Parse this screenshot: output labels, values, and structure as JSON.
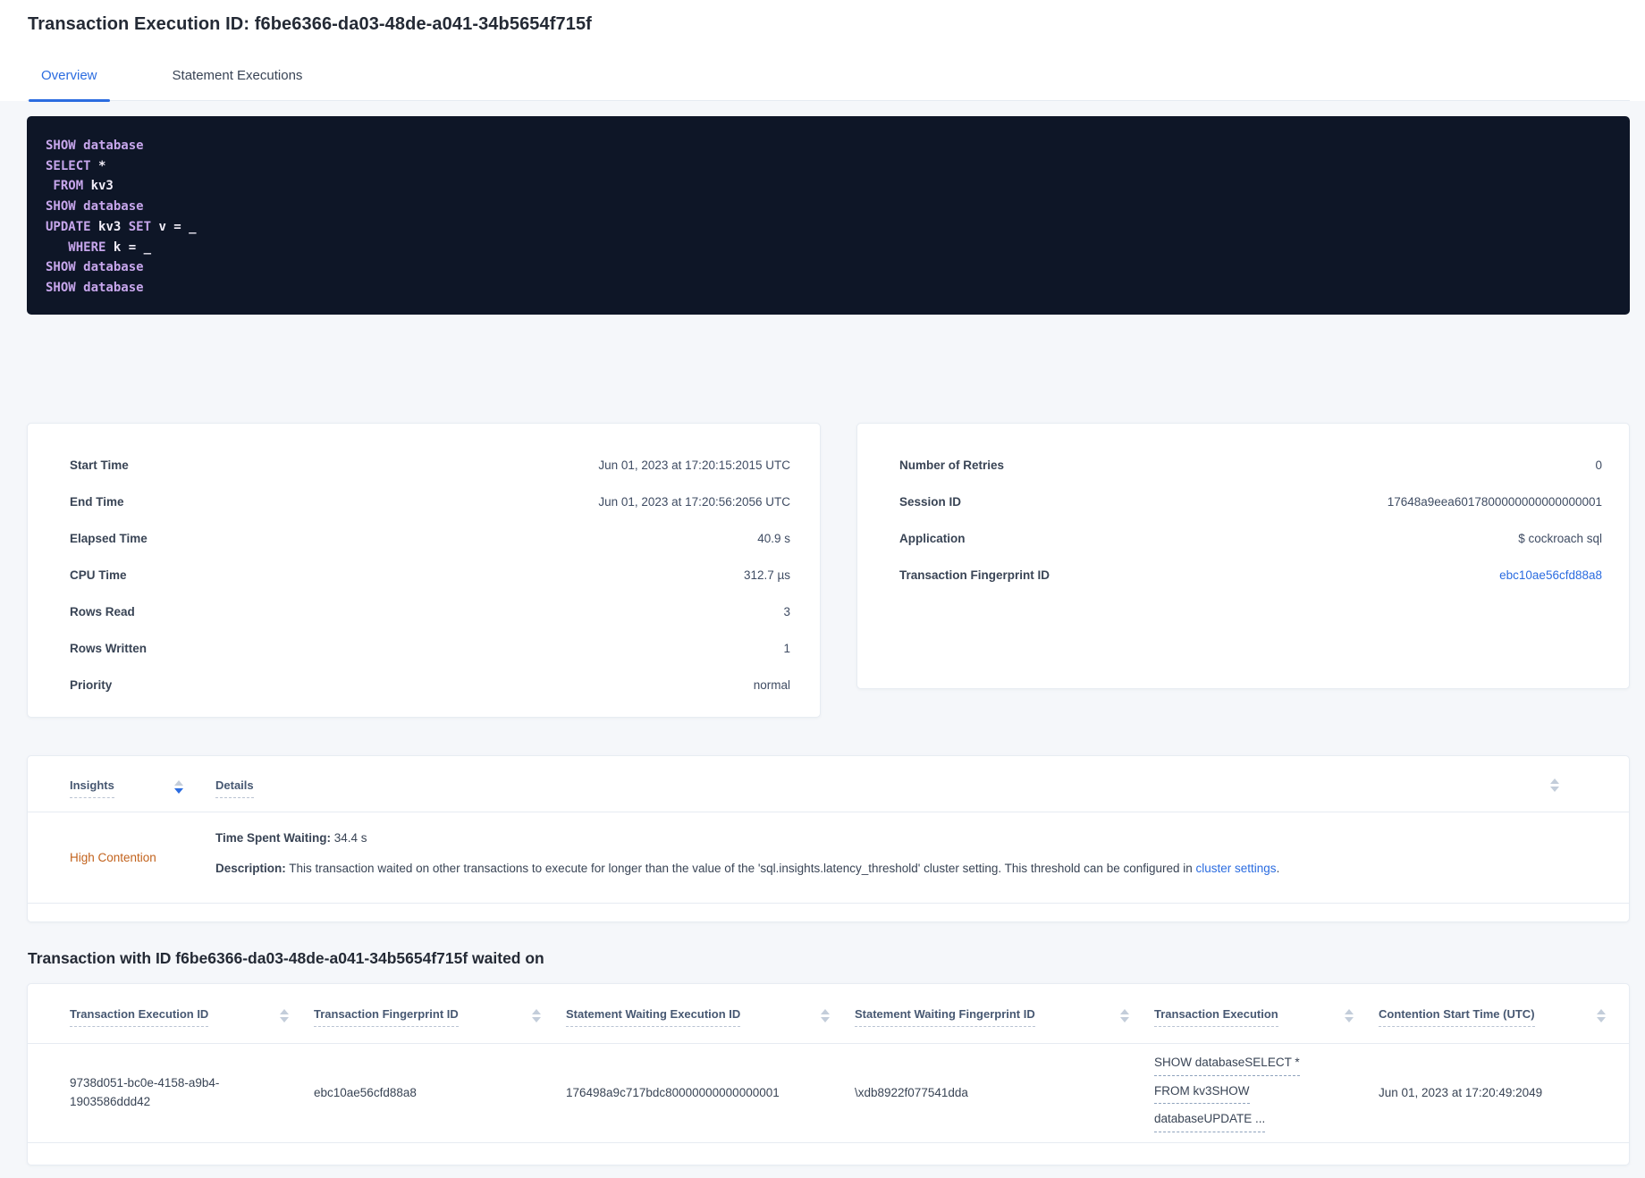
{
  "header": {
    "title": "Transaction Execution ID: f6be6366-da03-48de-a041-34b5654f715f"
  },
  "tabs": {
    "overview": "Overview",
    "statement_executions": "Statement Executions"
  },
  "sql_box": {
    "lines": [
      [
        {
          "text": "SHOW database",
          "kw": true
        }
      ],
      [
        {
          "text": "SELECT ",
          "kw": true
        },
        {
          "text": "*",
          "kw": false
        }
      ],
      [
        {
          "text": " FROM ",
          "kw": true
        },
        {
          "text": "kv3",
          "kw": false
        }
      ],
      [
        {
          "text": "SHOW database",
          "kw": true
        }
      ],
      [
        {
          "text": "UPDATE ",
          "kw": true
        },
        {
          "text": "kv3 ",
          "kw": false
        },
        {
          "text": "SET ",
          "kw": true
        },
        {
          "text": "v = _",
          "kw": false
        }
      ],
      [
        {
          "text": "   WHERE ",
          "kw": true
        },
        {
          "text": "k = _",
          "kw": false
        }
      ],
      [
        {
          "text": "SHOW database",
          "kw": true
        }
      ],
      [
        {
          "text": "SHOW database",
          "kw": true
        }
      ]
    ]
  },
  "summary_left": {
    "rows": [
      {
        "label": "Start Time",
        "value": "Jun 01, 2023 at 17:20:15:2015 UTC"
      },
      {
        "label": "End Time",
        "value": "Jun 01, 2023 at 17:20:56:2056 UTC"
      },
      {
        "label": "Elapsed Time",
        "value": "40.9 s"
      },
      {
        "label": "CPU Time",
        "value": "312.7 µs"
      },
      {
        "label": "Rows Read",
        "value": "3"
      },
      {
        "label": "Rows Written",
        "value": "1"
      },
      {
        "label": "Priority",
        "value": "normal"
      }
    ]
  },
  "summary_right": {
    "rows": [
      {
        "label": "Number of Retries",
        "value": "0"
      },
      {
        "label": "Session ID",
        "value": "17648a9eea6017800000000000000001"
      },
      {
        "label": "Application",
        "value": "$ cockroach sql"
      },
      {
        "label": "Transaction Fingerprint ID",
        "value": "ebc10ae56cfd88a8"
      }
    ]
  },
  "insights": {
    "columns": {
      "insights_label": "Insights",
      "details_label": "Details"
    },
    "row": {
      "insight": "High Contention",
      "waiting_label": "Time Spent Waiting:",
      "waiting_value": " 34.4 s",
      "description_label": "Description:",
      "description_text": " This transaction waited on other transactions to execute for longer than the value of the 'sql.insights.latency_threshold' cluster setting. This threshold can be configured in ",
      "description_link": "cluster settings",
      "description_suffix": "."
    }
  },
  "waited_on": {
    "heading": "Transaction with ID f6be6366-da03-48de-a041-34b5654f715f waited on",
    "columns": [
      "Transaction Execution ID",
      "Transaction Fingerprint ID",
      "Statement Waiting Execution ID",
      "Statement Waiting Fingerprint ID",
      "Transaction Execution",
      "Contention Start Time (UTC)"
    ],
    "row": {
      "transaction_execution_id": "9738d051-bc0e-4158-a9b4-1903586ddd42",
      "transaction_fingerprint_id": "ebc10ae56cfd88a8",
      "statement_waiting_execution_id": "176498a9c717bdc80000000000000001",
      "statement_waiting_fingerprint_id": "\\xdb8922f077541dda",
      "transaction_execution_lines": [
        "SHOW databaseSELECT *",
        "FROM kv3SHOW",
        "databaseUPDATE ..."
      ],
      "contention_start_time": "Jun 01, 2023 at 17:20:49:2049"
    }
  },
  "colors": {
    "accent_blue": "#2b6ce0",
    "insight_orange": "#c2621c",
    "sql_keyword_purple": "#c7a6ec",
    "sql_background": "#0e1627",
    "page_background": "#f5f7fa"
  }
}
